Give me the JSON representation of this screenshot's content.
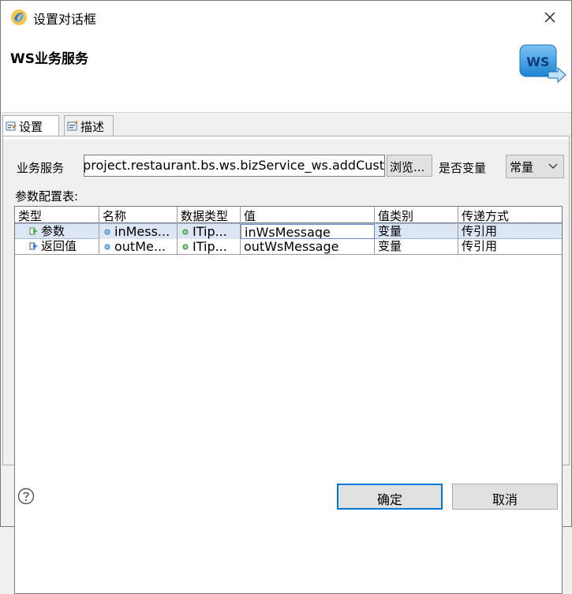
{
  "window": {
    "title": "设置对话框"
  },
  "header": {
    "title": "WS业务服务",
    "logo_text": "WS"
  },
  "tabs": [
    {
      "label": "设置"
    },
    {
      "label": "描述"
    }
  ],
  "settings": {
    "service_label": "业务服务",
    "service_value": "com.project.restaurant.bs.ws.bizService_ws.addCust",
    "browse_label": "浏览...",
    "variable_label": "是否变量",
    "variable_value": "常量",
    "params_label": "参数配置表:"
  },
  "table": {
    "columns": [
      "类型",
      "名称",
      "数据类型",
      "值",
      "值类别",
      "传递方式"
    ],
    "rows": [
      {
        "type": "参数",
        "name": "inMess...",
        "datatype": "ITip...",
        "value": "inWsMessage",
        "value_kind": "变量",
        "pass_mode": "传引用"
      },
      {
        "type": "返回值",
        "name": "outMe...",
        "datatype": "ITip...",
        "value": "outWsMessage",
        "value_kind": "变量",
        "pass_mode": "传引用"
      }
    ]
  },
  "footer": {
    "ok_label": "确定",
    "cancel_label": "取消"
  },
  "colors": {
    "accent": "#0078d7",
    "selection": "#dde6f5"
  }
}
